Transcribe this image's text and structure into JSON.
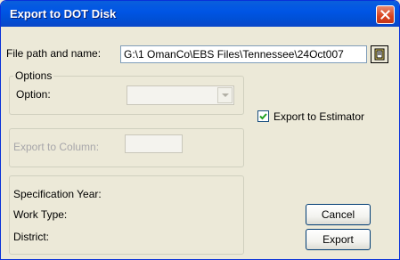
{
  "window": {
    "title": "Export to DOT Disk"
  },
  "file": {
    "label": "File path and name:",
    "value": "G:\\1 OmanCo\\EBS Files\\Tennessee\\24Oct007"
  },
  "options": {
    "legend": "Options",
    "option_label": "Option:",
    "option_value": ""
  },
  "estimator": {
    "label": "Export to Estimator",
    "checked": true
  },
  "column": {
    "label": "Export to Column:",
    "value": ""
  },
  "info": {
    "spec_year_label": "Specification Year:",
    "work_type_label": "Work Type:",
    "district_label": "District:"
  },
  "buttons": {
    "cancel": "Cancel",
    "export": "Export"
  },
  "icons": {
    "close": "close-icon",
    "browse": "folder-browse-icon",
    "dropdown": "chevron-down-icon"
  },
  "colors": {
    "titlebar": "#0055e5",
    "close": "#d8421d",
    "face": "#ece9d8"
  }
}
